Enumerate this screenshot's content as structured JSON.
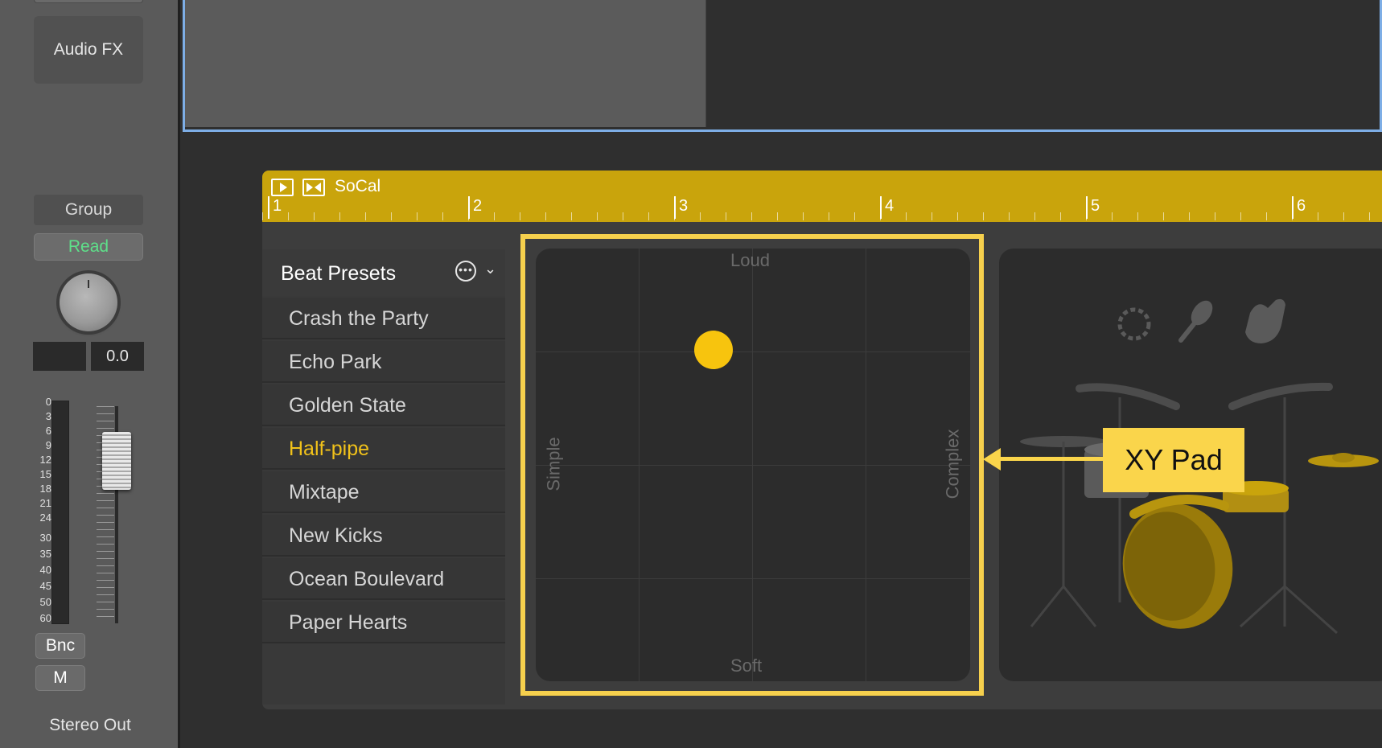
{
  "channel_strip": {
    "audio_fx_label": "Audio FX",
    "group_label": "Group",
    "automation_mode": "Read",
    "volume_value": "0.0",
    "meter_scale": [
      "0",
      "3",
      "6",
      "9",
      "12",
      "15",
      "18",
      "21",
      "24",
      "30",
      "35",
      "40",
      "45",
      "50",
      "60"
    ],
    "bounce_label": "Bnc",
    "mute_label": "M",
    "output_label": "Stereo Out"
  },
  "region": {
    "name": "SoCal",
    "bars": [
      "1",
      "2",
      "3",
      "4",
      "5",
      "6"
    ]
  },
  "presets": {
    "title": "Beat Presets",
    "items": [
      {
        "label": "Crash the Party",
        "active": false
      },
      {
        "label": "Echo Park",
        "active": false
      },
      {
        "label": "Golden State",
        "active": false
      },
      {
        "label": "Half-pipe",
        "active": true
      },
      {
        "label": "Mixtape",
        "active": false
      },
      {
        "label": "New Kicks",
        "active": false
      },
      {
        "label": "Ocean Boulevard",
        "active": false
      },
      {
        "label": "Paper Hearts",
        "active": false
      }
    ]
  },
  "xy_pad": {
    "top_label": "Loud",
    "bottom_label": "Soft",
    "left_label": "Simple",
    "right_label": "Complex",
    "puck_color": "#f7c40e"
  },
  "kit_icons": [
    "tambourine-icon",
    "shaker-icon",
    "clap-icon"
  ],
  "callout": {
    "label": "XY Pad",
    "color": "#fad54b"
  },
  "colors": {
    "region_header": "#c9a40c",
    "active_preset": "#f1c21a",
    "read_mode": "#5ee08a",
    "selection_border": "#7eaee6"
  }
}
